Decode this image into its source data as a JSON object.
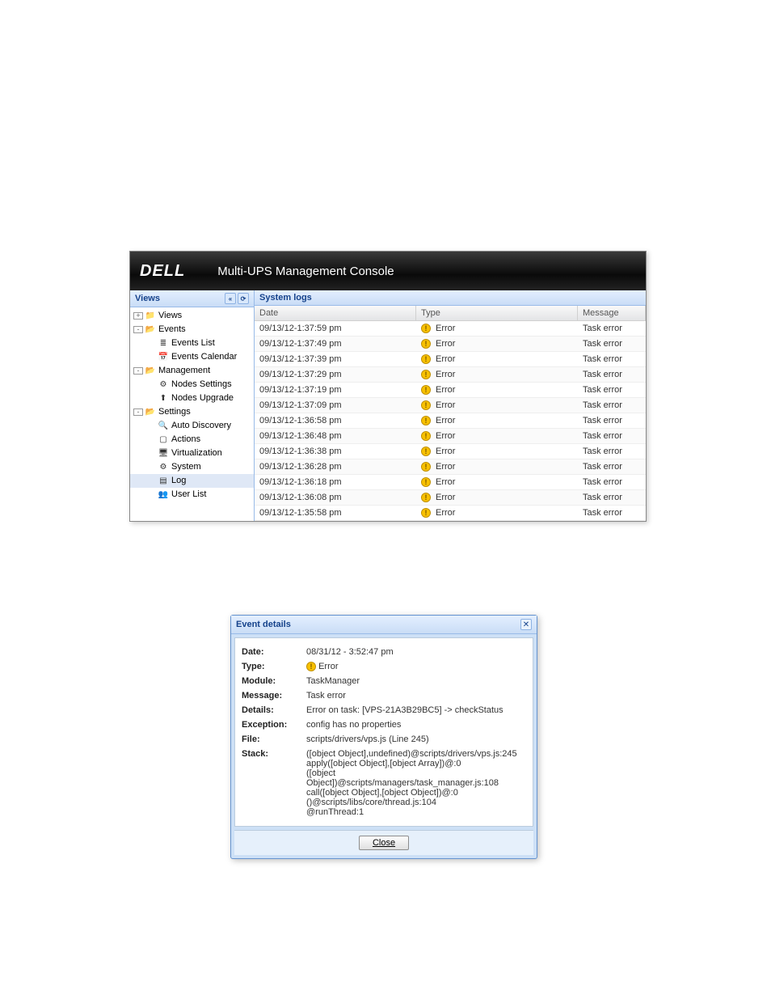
{
  "console": {
    "logo": "DELL",
    "title": "Multi-UPS Management Console",
    "sidebar": {
      "header": "Views",
      "tree": [
        {
          "label": "Views",
          "icon": "folder",
          "indent": 0,
          "toggle": "+"
        },
        {
          "label": "Events",
          "icon": "folder-open",
          "indent": 0,
          "toggle": "-"
        },
        {
          "label": "Events List",
          "icon": "list",
          "indent": 1
        },
        {
          "label": "Events Calendar",
          "icon": "calendar",
          "indent": 1
        },
        {
          "label": "Management",
          "icon": "folder-open",
          "indent": 0,
          "toggle": "-"
        },
        {
          "label": "Nodes Settings",
          "icon": "node",
          "indent": 1
        },
        {
          "label": "Nodes Upgrade",
          "icon": "upgrade",
          "indent": 1
        },
        {
          "label": "Settings",
          "icon": "folder-open",
          "indent": 0,
          "toggle": "-"
        },
        {
          "label": "Auto Discovery",
          "icon": "discovery",
          "indent": 1
        },
        {
          "label": "Actions",
          "icon": "actions",
          "indent": 1
        },
        {
          "label": "Virtualization",
          "icon": "virt",
          "indent": 1
        },
        {
          "label": "System",
          "icon": "system",
          "indent": 1
        },
        {
          "label": "Log",
          "icon": "log",
          "indent": 1,
          "selected": true
        },
        {
          "label": "User List",
          "icon": "users",
          "indent": 1
        }
      ]
    },
    "grid": {
      "title": "System logs",
      "columns": {
        "date": "Date",
        "type": "Type",
        "message": "Message"
      },
      "rows": [
        {
          "date": "09/13/12-1:37:59 pm",
          "type": "Error",
          "message": "Task error"
        },
        {
          "date": "09/13/12-1:37:49 pm",
          "type": "Error",
          "message": "Task error"
        },
        {
          "date": "09/13/12-1:37:39 pm",
          "type": "Error",
          "message": "Task error"
        },
        {
          "date": "09/13/12-1:37:29 pm",
          "type": "Error",
          "message": "Task error"
        },
        {
          "date": "09/13/12-1:37:19 pm",
          "type": "Error",
          "message": "Task error"
        },
        {
          "date": "09/13/12-1:37:09 pm",
          "type": "Error",
          "message": "Task error"
        },
        {
          "date": "09/13/12-1:36:58 pm",
          "type": "Error",
          "message": "Task error"
        },
        {
          "date": "09/13/12-1:36:48 pm",
          "type": "Error",
          "message": "Task error"
        },
        {
          "date": "09/13/12-1:36:38 pm",
          "type": "Error",
          "message": "Task error"
        },
        {
          "date": "09/13/12-1:36:28 pm",
          "type": "Error",
          "message": "Task error"
        },
        {
          "date": "09/13/12-1:36:18 pm",
          "type": "Error",
          "message": "Task error"
        },
        {
          "date": "09/13/12-1:36:08 pm",
          "type": "Error",
          "message": "Task error"
        },
        {
          "date": "09/13/12-1:35:58 pm",
          "type": "Error",
          "message": "Task error"
        }
      ]
    }
  },
  "dialog": {
    "title": "Event details",
    "labels": {
      "date": "Date:",
      "type": "Type:",
      "module": "Module:",
      "message": "Message:",
      "details": "Details:",
      "exception": "Exception:",
      "file": "File:",
      "stack": "Stack:"
    },
    "values": {
      "date": "08/31/12 - 3:52:47 pm",
      "type": "Error",
      "module": "TaskManager",
      "message": "Task error",
      "details": "Error on task: [VPS-21A3B29BC5] -> checkStatus",
      "exception": "config has no properties",
      "file": "scripts/drivers/vps.js (Line 245)",
      "stack": "([object Object],undefined)@scripts/drivers/vps.js:245\napply([object Object],[object Array])@:0\n([object Object])@scripts/managers/task_manager.js:108\ncall([object Object],[object Object])@:0\n()@scripts/libs/core/thread.js:104\n@runThread:1"
    },
    "close_btn": "Close"
  }
}
